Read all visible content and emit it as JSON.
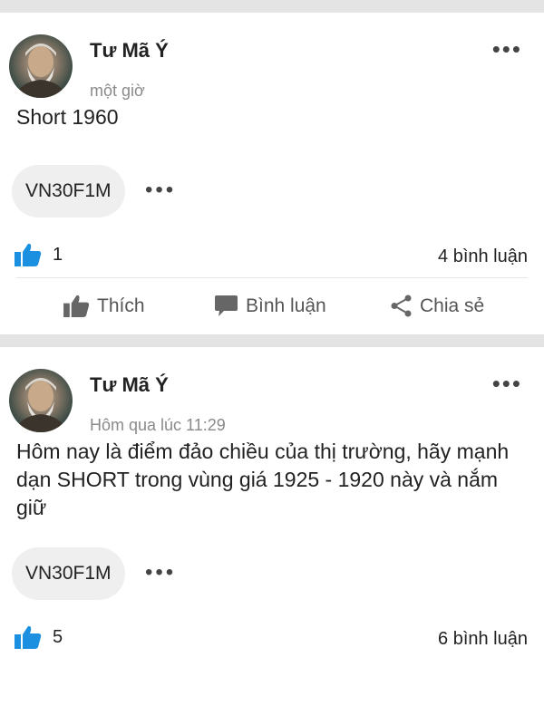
{
  "posts": [
    {
      "author": "Tư Mã Ý",
      "time": "một giờ",
      "content": "Short 1960",
      "tag": "VN30F1M",
      "likes": "1",
      "comments": "4 bình luận"
    },
    {
      "author": "Tư Mã Ý",
      "time": "Hôm qua lúc 11:29",
      "content": "Hôm nay là điểm đảo chiều của thị trường, hãy mạnh dạn SHORT trong vùng giá 1925 - 1920 này và nắm giữ",
      "tag": "VN30F1M",
      "likes": "5",
      "comments": "6 bình luận"
    }
  ],
  "actions": {
    "like": "Thích",
    "comment": "Bình luận",
    "share": "Chia sẻ"
  },
  "icons": {
    "more": "more-dots-icon",
    "like": "thumbs-up-icon",
    "comment": "speech-bubble-icon",
    "share": "share-icon"
  },
  "colors": {
    "like_blue": "#1b8fe0",
    "separator": "#e4e4e4"
  }
}
